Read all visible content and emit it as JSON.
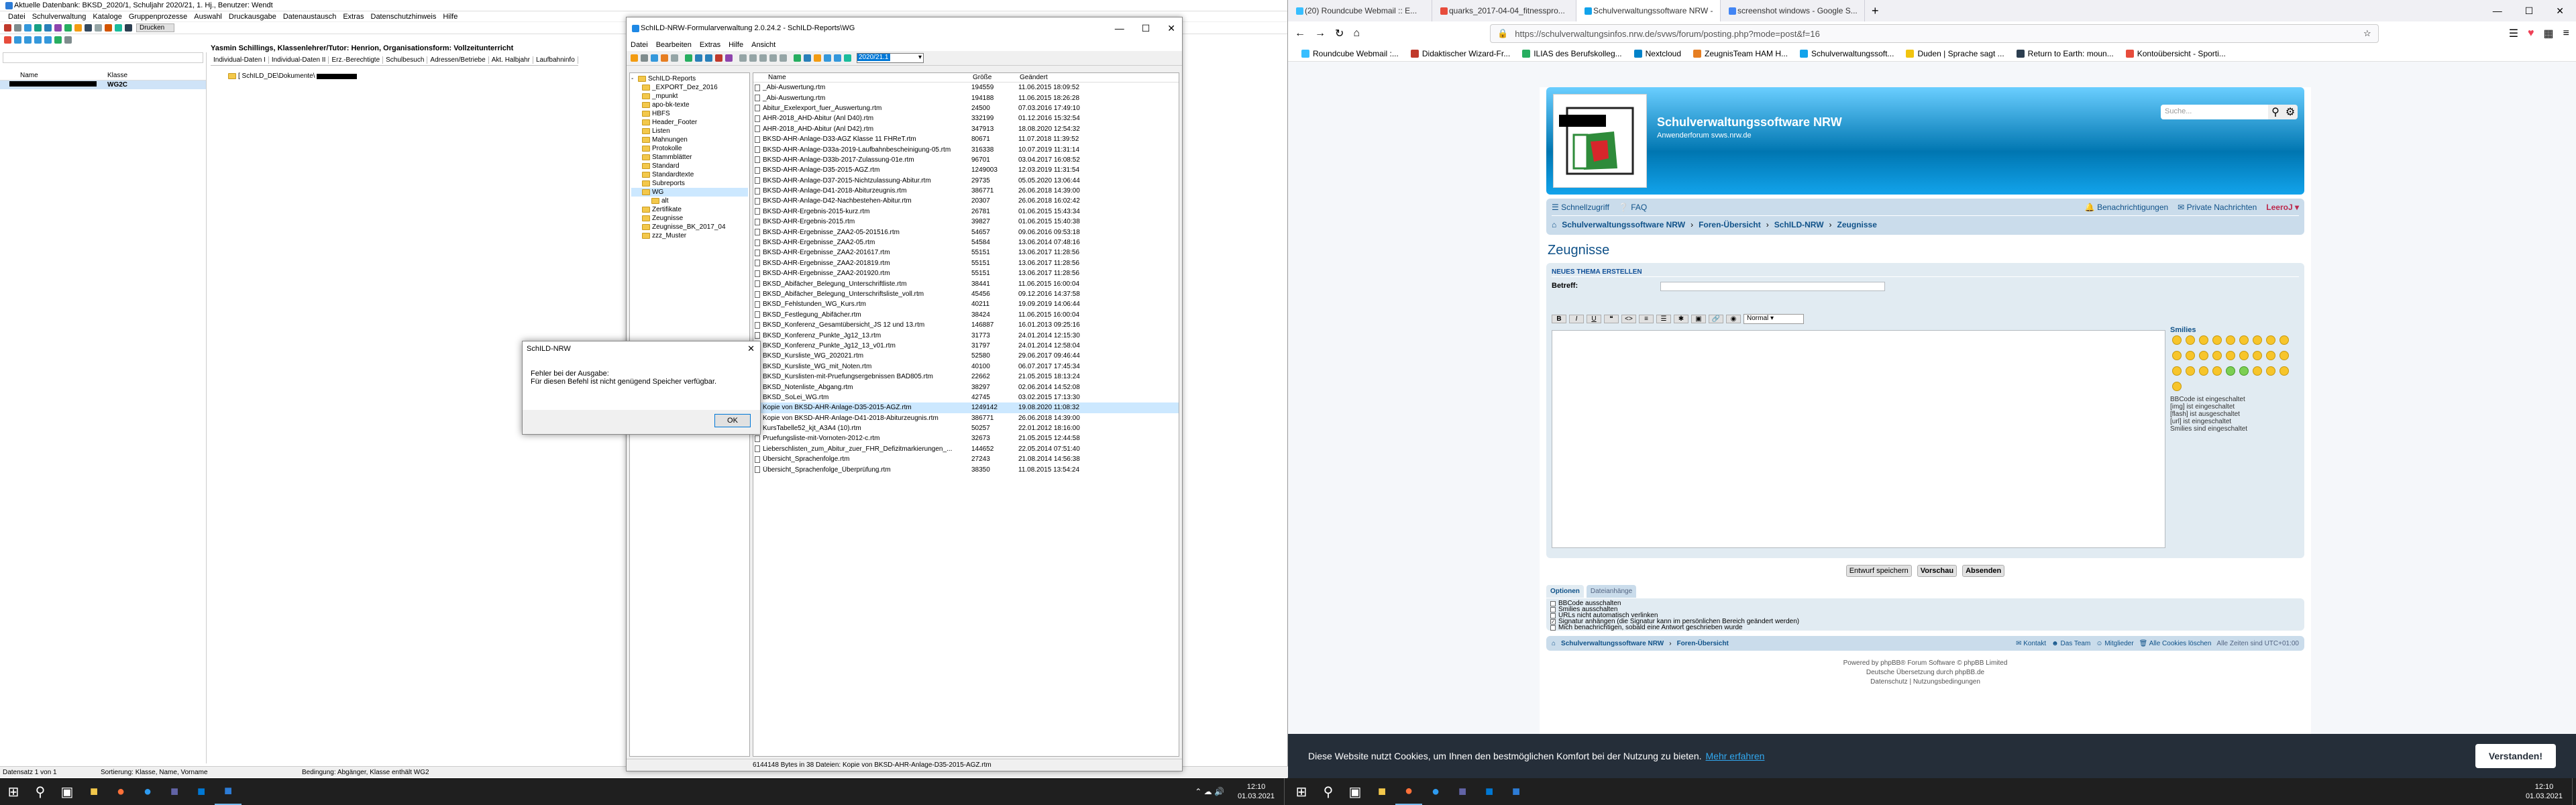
{
  "schild": {
    "title": "Aktuelle Datenbank: BKSD_2020/1, Schuljahr 2020/21, 1. Hj., Benutzer: Wendt",
    "menu": [
      "Datei",
      "Schulverwaltung",
      "Kataloge",
      "Gruppenprozesse",
      "Auswahl",
      "Druckausgabe",
      "Datenaustausch",
      "Extras",
      "Datenschutzhinweis",
      "Hilfe"
    ],
    "print_label": "Drucken",
    "student_header": "Yasmin Schillings, Klassenlehrer/Tutor: Henrion, Organisationsform: Vollzeitunterricht",
    "tabs": [
      "Individual-Daten I",
      "Individual-Daten II",
      "Erz.-Berechtigte",
      "Schulbesuch",
      "Adressen/Betriebe",
      "Akt. Halbjahr",
      "Laufbahninfo"
    ],
    "list_headers": {
      "name": "Name",
      "class": "Klasse"
    },
    "selected_class": "WG2C",
    "path_display": "[ SchILD_DE\\Dokumente\\",
    "status": {
      "count": "Datensatz 1 von 1",
      "sort": "Sortierung: Klasse, Name, Vorname",
      "cond": "Bedingung: Abgänger, Klasse enthält WG2"
    }
  },
  "formwin": {
    "title": "SchILD-NRW-Formularverwaltung 2.0.24.2 - SchILD-Reports\\WG",
    "menu": [
      "Datei",
      "Bearbeiten",
      "Extras",
      "Hilfe",
      "Ansicht"
    ],
    "year": "2020/21.1",
    "tree_root": "SchILD-Reports",
    "tree": [
      "_EXPORT_Dez_2016",
      "_mpunkt",
      "apo-bk-texte",
      "HBFS",
      "Header_Footer",
      "Listen",
      "Mahnungen",
      "Protokolle",
      "Stammblätter",
      "Standard",
      "Standardtexte",
      "Subreports",
      "WG",
      "alt",
      "Zertifikate",
      "Zeugnisse",
      "Zeugnisse_BK_2017_04",
      "zzz_Muster"
    ],
    "col_headers": {
      "name": "Name",
      "size": "Größe",
      "changed": "Geändert"
    },
    "files": [
      [
        "_Abi-Auswertung.rtm",
        "194559",
        "11.06.2015 18:09:52"
      ],
      [
        "_Abi-Auswertung.rtm",
        "194188",
        "11.06.2015 18:26:28"
      ],
      [
        "Abitur_Exelexport_fuer_Auswertung.rtm",
        "24500",
        "07.03.2016 17:49:10"
      ],
      [
        "AHR-2018_AHD-Abitur (Anl D40).rtm",
        "332199",
        "01.12.2016 15:32:54"
      ],
      [
        "AHR-2018_AHD-Abitur (Anl D42).rtm",
        "347913",
        "18.08.2020 12:54:32"
      ],
      [
        "BKSD-AHR-Anlage-D33-AGZ Klasse 11 FHReT.rtm",
        "80671",
        "11.07.2018 11:39:52"
      ],
      [
        "BKSD-AHR-Anlage-D33a-2019-Laufbahnbescheinigung-05.rtm",
        "316338",
        "10.07.2019 11:31:14"
      ],
      [
        "BKSD-AHR-Anlage-D33b-2017-Zulassung-01e.rtm",
        "96701",
        "03.04.2017 16:08:52"
      ],
      [
        "BKSD-AHR-Anlage-D35-2015-AGZ.rtm",
        "1249003",
        "12.03.2019 11:31:54"
      ],
      [
        "BKSD-AHR-Anlage-D37-2015-Nichtzulassung-Abitur.rtm",
        "29735",
        "05.05.2020 13:06:44"
      ],
      [
        "BKSD-AHR-Anlage-D41-2018-Abiturzeugnis.rtm",
        "386771",
        "26.06.2018 14:39:00"
      ],
      [
        "BKSD-AHR-Anlage-D42-Nachbestehen-Abitur.rtm",
        "20307",
        "26.06.2018 16:02:42"
      ],
      [
        "BKSD-AHR-Ergebnis-2015-kurz.rtm",
        "26781",
        "01.06.2015 15:43:34"
      ],
      [
        "BKSD-AHR-Ergebnis-2015.rtm",
        "39827",
        "01.06.2015 15:40:38"
      ],
      [
        "BKSD-AHR-Ergebnisse_ZAA2-05-201516.rtm",
        "54657",
        "09.06.2016 09:53:18"
      ],
      [
        "BKSD-AHR-Ergebnisse_ZAA2-05.rtm",
        "54584",
        "13.06.2014 07:48:16"
      ],
      [
        "BKSD-AHR-Ergebnisse_ZAA2-201617.rtm",
        "55151",
        "13.06.2017 11:28:56"
      ],
      [
        "BKSD-AHR-Ergebnisse_ZAA2-201819.rtm",
        "55151",
        "13.06.2017 11:28:56"
      ],
      [
        "BKSD-AHR-Ergebnisse_ZAA2-201920.rtm",
        "55151",
        "13.06.2017 11:28:56"
      ],
      [
        "BKSD_Abifächer_Belegung_Unterschriftliste.rtm",
        "38441",
        "11.06.2015 16:00:04"
      ],
      [
        "BKSD_Abifächer_Belegung_Unterschriftsliste_voll.rtm",
        "45456",
        "09.12.2016 14:37:58"
      ],
      [
        "BKSD_Fehlstunden_WG_Kurs.rtm",
        "40211",
        "19.09.2019 14:06:44"
      ],
      [
        "BKSD_Festlegung_Abifächer.rtm",
        "38424",
        "11.06.2015 16:00:04"
      ],
      [
        "BKSD_Konferenz_Gesamtübersicht_JS 12 und 13.rtm",
        "146887",
        "16.01.2013 09:25:16"
      ],
      [
        "BKSD_Konferenz_Punkte_Jg12_13.rtm",
        "31773",
        "24.01.2014 12:15:30"
      ],
      [
        "BKSD_Konferenz_Punkte_Jg12_13_v01.rtm",
        "31797",
        "24.01.2014 12:58:04"
      ],
      [
        "BKSD_Kursliste_WG_202021.rtm",
        "52580",
        "29.06.2017 09:46:44"
      ],
      [
        "BKSD_Kursliste_WG_mit_Noten.rtm",
        "40100",
        "06.07.2017 17:45:34"
      ],
      [
        "BKSD_Kurslisten-mit-Pruefungsergebnissen BAD805.rtm",
        "22662",
        "21.05.2015 18:13:24"
      ],
      [
        "BKSD_Notenliste_Abgang.rtm",
        "38297",
        "02.06.2014 14:52:08"
      ],
      [
        "BKSD_SoLei_WG.rtm",
        "42745",
        "03.02.2015 17:13:30"
      ],
      [
        "Kopie von BKSD-AHR-Anlage-D35-2015-AGZ.rtm",
        "1249142",
        "19.08.2020 11:08:32"
      ],
      [
        "Kopie von BKSD-AHR-Anlage-D41-2018-Abiturzeugnis.rtm",
        "386771",
        "26.06.2018 14:39:00"
      ],
      [
        "KursTabelle52_kjt_A3A4 (10).rtm",
        "50257",
        "22.01.2012 18:16:00"
      ],
      [
        "Pruefungsliste-mit-Vornoten-2012-c.rtm",
        "32673",
        "21.05.2015 12:44:58"
      ],
      [
        "Lieberschlisten_zum_Abitur_zuer_FHR_Defizitmarkierungen_...",
        "144652",
        "22.05.2014 07:51:40"
      ],
      [
        "Übersicht_Sprachenfolge.rtm",
        "27243",
        "21.08.2014 14:56:38"
      ],
      [
        "Übersicht_Sprachenfolge_Überprüfung.rtm",
        "38350",
        "11.08.2015 13:54:24"
      ]
    ],
    "status": "6144148 Bytes in 38 Dateien: Kopie von BKSD-AHR-Anlage-D35-2015-AGZ.rtm"
  },
  "dialog": {
    "title": "SchILD-NRW",
    "line1": "Fehler bei der Ausgabe:",
    "line2": "Für diesen Befehl ist nicht genügend Speicher verfügbar.",
    "ok": "OK"
  },
  "browser": {
    "tabs": [
      "(20) Roundcube Webmail :: E...",
      "quarks_2017-04-04_fitnesspro...",
      "Schulverwaltungssoftware NRW -",
      "screenshot windows - Google S..."
    ],
    "url": "https://schulverwaltungsinfos.nrw.de/svws/forum/posting.php?mode=post&f=16",
    "bookmarks": [
      "Roundcube Webmail :...",
      "Didaktischer Wizard-Fr...",
      "ILIAS des Berufskolleg...",
      "Nextcloud",
      "ZeugnisTeam HAM H...",
      "Schulverwaltungssoft...",
      "Duden | Sprache sagt ...",
      "Return to Earth: moun...",
      "Kontoübersicht - Sporti..."
    ],
    "forum": {
      "site_title": "Schulverwaltungssoftware NRW",
      "site_sub": "Anwenderforum svws.nrw.de",
      "search_placeholder": "Suche...",
      "quicklinks": "Schnellzugriff",
      "faq": "FAQ",
      "notifications": "Benachrichtigungen",
      "pms": "Private Nachrichten",
      "user": "LeeroJ",
      "breadcrumb": [
        "Schulverwaltungssoftware NRW",
        "Foren-Übersicht",
        "SchILD-NRW",
        "Zeugnisse"
      ],
      "heading": "Zeugnisse",
      "new_topic": "NEUES THEMA ERSTELLEN",
      "subject_label": "Betreff:",
      "font_size": "Normal",
      "smilies_label": "Smilies",
      "bbcode_info": [
        "BBCode ist eingeschaltet",
        "[img] ist eingeschaltet",
        "[flash] ist ausgeschaltet",
        "[url] ist eingeschaltet",
        "Smilies sind eingeschaltet"
      ],
      "buttons": [
        "Entwurf speichern",
        "Vorschau",
        "Absenden"
      ],
      "option_tabs": [
        "Optionen",
        "Dateianhänge"
      ],
      "options": [
        "BBCode ausschalten",
        "Smilies ausschalten",
        "URLs nicht automatisch verlinken",
        "Signatur anhängen (die Signatur kann im persönlichen Bereich geändert werden)",
        "Mich benachrichtigen, sobald eine Antwort geschrieben wurde"
      ],
      "options_checked": [
        false,
        false,
        false,
        true,
        false
      ],
      "footer_links": [
        "Schulverwaltungssoftware NRW",
        "Foren-Übersicht"
      ],
      "footer_right": [
        "Kontakt",
        "Das Team",
        "Mitglieder",
        "Alle Cookies löschen",
        "Alle Zeiten sind UTC+01:00"
      ],
      "powered": "Powered by phpBB® Forum Software © phpBB Limited",
      "translation": "Deutsche Übersetzung durch phpBB.de",
      "privacy": "Datenschutz | Nutzungsbedingungen"
    },
    "cookie": {
      "text": "Diese Website nutzt Cookies, um Ihnen den bestmöglichen Komfort bei der Nutzung zu bieten.",
      "link": "Mehr erfahren",
      "button": "Verstanden!"
    }
  },
  "taskbar": {
    "time": "12:10",
    "date": "01.03.2021"
  },
  "colors": {
    "phpbb_blue": "#12a3eb",
    "dark_blue": "#105289",
    "cookie_bg": "#252e39",
    "taskbar": "#1f1f1f"
  }
}
